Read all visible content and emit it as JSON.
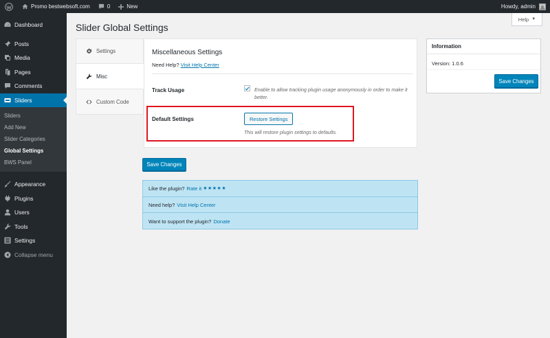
{
  "adminbar": {
    "site_name": "Promo bestwebsoft.com",
    "comments_count": "0",
    "new_label": "New",
    "greeting": "Howdy, admin"
  },
  "sidebar": {
    "items_top": [
      {
        "label": "Dashboard",
        "icon": "dashboard-icon"
      },
      {
        "label": "Posts",
        "icon": "pin-icon"
      },
      {
        "label": "Media",
        "icon": "media-icon"
      },
      {
        "label": "Pages",
        "icon": "pages-icon"
      },
      {
        "label": "Comments",
        "icon": "comment-icon"
      },
      {
        "label": "Sliders",
        "icon": "slider-icon"
      }
    ],
    "submenu": [
      "Sliders",
      "Add New",
      "Slider Categories",
      "Global Settings",
      "BWS Panel"
    ],
    "items_bottom": [
      {
        "label": "Appearance",
        "icon": "brush-icon"
      },
      {
        "label": "Plugins",
        "icon": "plugin-icon"
      },
      {
        "label": "Users",
        "icon": "users-icon"
      },
      {
        "label": "Tools",
        "icon": "wrench-icon"
      },
      {
        "label": "Settings",
        "icon": "settings-icon"
      },
      {
        "label": "Collapse menu",
        "icon": "collapse-icon"
      }
    ]
  },
  "page": {
    "title": "Slider Global Settings",
    "help_label": "Help"
  },
  "tabs": [
    {
      "label": "Settings",
      "icon": "gear-icon"
    },
    {
      "label": "Misc",
      "icon": "wrench-icon"
    },
    {
      "label": "Custom Code",
      "icon": "code-icon"
    }
  ],
  "panel": {
    "heading": "Miscellaneous Settings",
    "need_help": "Need Help?",
    "help_link": "Visit Help Center",
    "track_label": "Track Usage",
    "track_desc": "Enable to allow tracking plugin usage anonymously in order to make it better.",
    "default_label": "Default Settings",
    "restore_button": "Restore Settings",
    "restore_desc": "This will restore plugin settings to defaults."
  },
  "save_label": "Save Changes",
  "notices": {
    "like": "Like the plugin?",
    "rate": "Rate it",
    "stars": "★★★★★",
    "need_help": "Need help?",
    "help_center": "Visit Help Center",
    "support": "Want to support the plugin?",
    "donate": "Donate"
  },
  "info": {
    "title": "Information",
    "version": "Version: 1.0.6",
    "save_label": "Save Changes"
  },
  "colors": {
    "accent": "#0073aa",
    "primary_button": "#0085ba",
    "highlight": "#e0141e",
    "notice_bg": "#bee4f4"
  }
}
